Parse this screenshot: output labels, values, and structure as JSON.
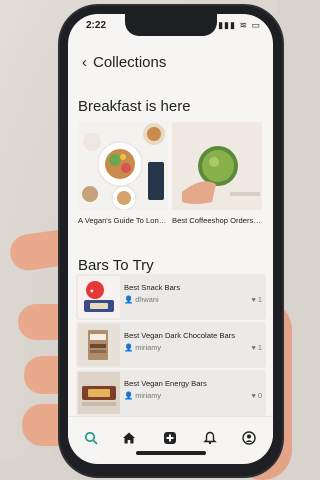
{
  "status_bar": {
    "time": "2:22",
    "icons": "▮▮▮ ≋ ▭"
  },
  "header": {
    "title": "Collections"
  },
  "sections": {
    "breakfast": {
      "title": "Breakfast is here",
      "cards": [
        {
          "caption": "A Vegan's Guide To London: Where To G..."
        },
        {
          "caption": "Best Coffeeshop Orders In Singapore"
        }
      ]
    },
    "bars": {
      "title": "Bars To Try",
      "items": [
        {
          "name": "Best Snack Bars",
          "user": "dhwani",
          "likes": "1"
        },
        {
          "name": "Best Vegan Dark Chocolate Bars",
          "user": "miriamy",
          "likes": "1"
        },
        {
          "name": "Best Vegan Energy Bars",
          "user": "miriamy",
          "likes": "0"
        }
      ]
    }
  },
  "tabs": [
    "search",
    "home",
    "add",
    "notifications",
    "profile"
  ],
  "colors": {
    "accent": "#2a9d8f",
    "text": "#222222",
    "muted": "#777777"
  }
}
